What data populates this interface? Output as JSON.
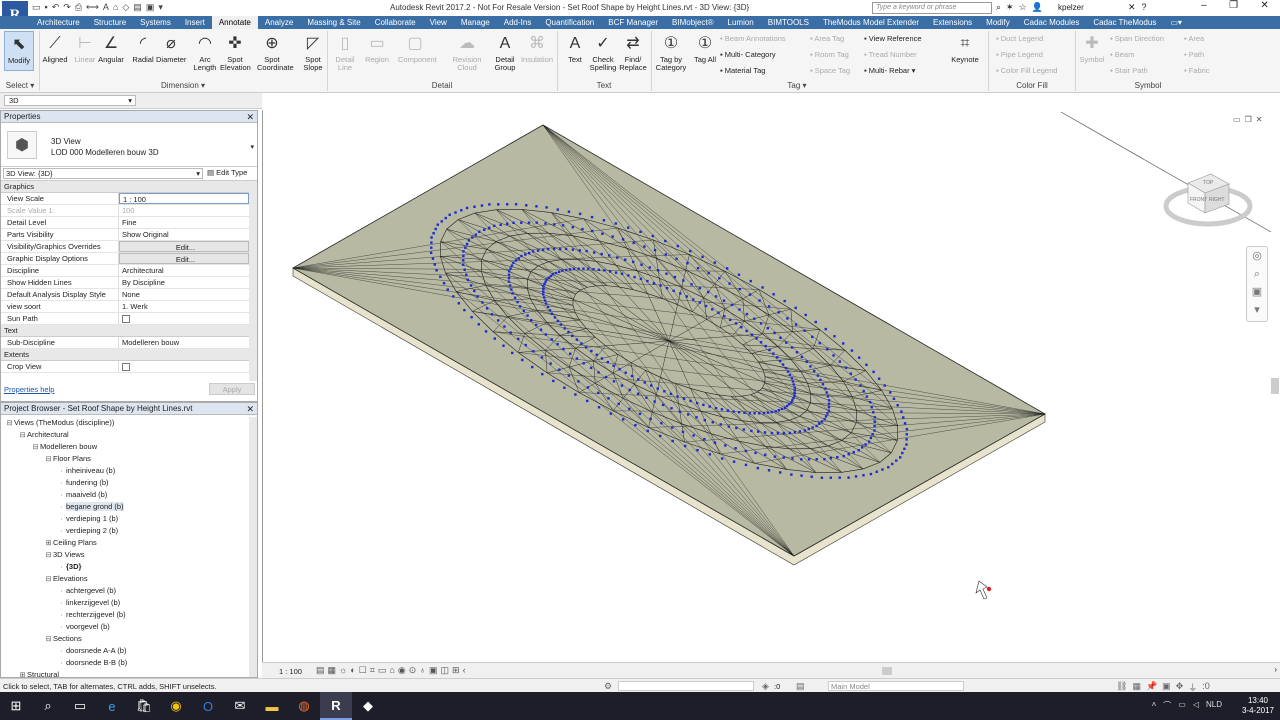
{
  "app": {
    "title": "Autodesk Revit 2017.2 -  Not For Resale Version -    Set Roof Shape by Height Lines.rvt - 3D View: {3D}",
    "logo": "R",
    "search_placeholder": "Type a keyword or phrase",
    "user": "kpelzer"
  },
  "tabs": [
    "Architecture",
    "Structure",
    "Systems",
    "Insert",
    "Annotate",
    "Analyze",
    "Massing & Site",
    "Collaborate",
    "View",
    "Manage",
    "Add-Ins",
    "Quantification",
    "BCF Manager",
    "BIMobject®",
    "Lumion",
    "BIMTOOLS",
    "TheModus Model Extender",
    "Extensions",
    "Modify",
    "Cadac Modules",
    "Cadac TheModus"
  ],
  "active_tab": "Annotate",
  "ribbon": {
    "modify": "Modify",
    "select": "Select ▾",
    "dimension": {
      "label": "Dimension ▾",
      "buttons": [
        "Aligned",
        "Linear",
        "Angular",
        "Radial",
        "Diameter",
        "Arc Length",
        "Spot Elevation",
        "Spot Coordinate",
        "Spot Slope"
      ]
    },
    "detail": {
      "label": "Detail",
      "buttons": [
        "Detail Line",
        "Region",
        "Component",
        "Revision Cloud",
        "Detail Group",
        "Insulation"
      ]
    },
    "text": {
      "label": "Text",
      "buttons": [
        "Text",
        "Check Spelling",
        "Find/ Replace"
      ]
    },
    "tag": {
      "label": "Tag ▾",
      "buttons": [
        "Tag by Category",
        "Tag All"
      ],
      "small": [
        "Beam Annotations",
        "Multi- Category",
        "Material Tag",
        "Area Tag",
        "Room Tag",
        "Space Tag",
        "View Reference",
        "Tread Number",
        "Multi- Rebar ▾"
      ]
    },
    "keynote": "Keynote",
    "colorfill": {
      "label": "Color Fill",
      "small": [
        "Duct Legend",
        "Pipe Legend",
        "Color Fill Legend"
      ]
    },
    "symbol": {
      "label": "Symbol",
      "button": "Symbol",
      "small": [
        "Span Direction",
        "Beam",
        "Stair Path",
        "Area",
        "Path",
        "Fabric"
      ]
    }
  },
  "selector": "3D",
  "properties": {
    "header": "Properties",
    "type_line1": "3D View",
    "type_line2": "LOD 000 Modelleren bouw 3D",
    "instance": "3D View: {3D}",
    "edit_type": "Edit Type",
    "groups": {
      "graphics": "Graphics",
      "text": "Text",
      "extents": "Extents"
    },
    "rows": [
      {
        "k": "View Scale",
        "v": "1 : 100"
      },
      {
        "k": "Scale Value    1:",
        "v": "100",
        "dis": true
      },
      {
        "k": "Detail Level",
        "v": "Fine"
      },
      {
        "k": "Parts Visibility",
        "v": "Show Original"
      },
      {
        "k": "Visibility/Graphics Overrides",
        "v": "Edit...",
        "btn": true
      },
      {
        "k": "Graphic Display Options",
        "v": "Edit...",
        "btn": true
      },
      {
        "k": "Discipline",
        "v": "Architectural"
      },
      {
        "k": "Show Hidden Lines",
        "v": "By Discipline"
      },
      {
        "k": "Default Analysis Display Style",
        "v": "None"
      },
      {
        "k": "view soort",
        "v": "1. Werk"
      },
      {
        "k": "Sun Path",
        "v": ""
      }
    ],
    "text_rows": [
      {
        "k": "Sub-Discipline",
        "v": "Modelleren bouw"
      }
    ],
    "extent_rows": [
      {
        "k": "Crop View",
        "v": ""
      }
    ],
    "help": "Properties help",
    "apply": "Apply"
  },
  "browser": {
    "header": "Project Browser - Set Roof Shape by Height Lines.rvt",
    "items": [
      {
        "t": "Views (TheModus (discipline))",
        "d": 0,
        "g": "⊟"
      },
      {
        "t": "Architectural",
        "d": 1,
        "g": "⊟"
      },
      {
        "t": "Modelleren bouw",
        "d": 2,
        "g": "⊟"
      },
      {
        "t": "Floor Plans",
        "d": 3,
        "g": "⊟"
      },
      {
        "t": "inheiniveau (b)",
        "d": 4,
        "g": ""
      },
      {
        "t": "fundering (b)",
        "d": 4,
        "g": ""
      },
      {
        "t": "maaiveld (b)",
        "d": 4,
        "g": ""
      },
      {
        "t": "begane grond (b)",
        "d": 4,
        "g": "",
        "sel": true
      },
      {
        "t": "verdieping 1 (b)",
        "d": 4,
        "g": ""
      },
      {
        "t": "verdieping 2 (b)",
        "d": 4,
        "g": ""
      },
      {
        "t": "Ceiling Plans",
        "d": 3,
        "g": "⊞"
      },
      {
        "t": "3D Views",
        "d": 3,
        "g": "⊟"
      },
      {
        "t": "{3D}",
        "d": 4,
        "g": "",
        "bold": true
      },
      {
        "t": "Elevations",
        "d": 3,
        "g": "⊟"
      },
      {
        "t": "achtergevel (b)",
        "d": 4,
        "g": ""
      },
      {
        "t": "linkerzijgevel (b)",
        "d": 4,
        "g": ""
      },
      {
        "t": "rechterzijgevel (b)",
        "d": 4,
        "g": ""
      },
      {
        "t": "voorgevel (b)",
        "d": 4,
        "g": ""
      },
      {
        "t": "Sections",
        "d": 3,
        "g": "⊟"
      },
      {
        "t": "doorsnede A-A (b)",
        "d": 4,
        "g": ""
      },
      {
        "t": "doorsnede B-B (b)",
        "d": 4,
        "g": ""
      },
      {
        "t": "Structural",
        "d": 1,
        "g": "⊞"
      }
    ]
  },
  "viewbar": {
    "scale": "1 : 100"
  },
  "status": {
    "hint": "Click to select, TAB for alternates, CTRL adds, SHIFT unselects.",
    "zero": ":0",
    "model": "Main Model"
  },
  "viewcube": {
    "top": "TOP",
    "front": "FRONT",
    "right": "RIGHT"
  },
  "taskbar": {
    "lang": "NLD",
    "time": "13:40",
    "date": "3-4-2017"
  }
}
